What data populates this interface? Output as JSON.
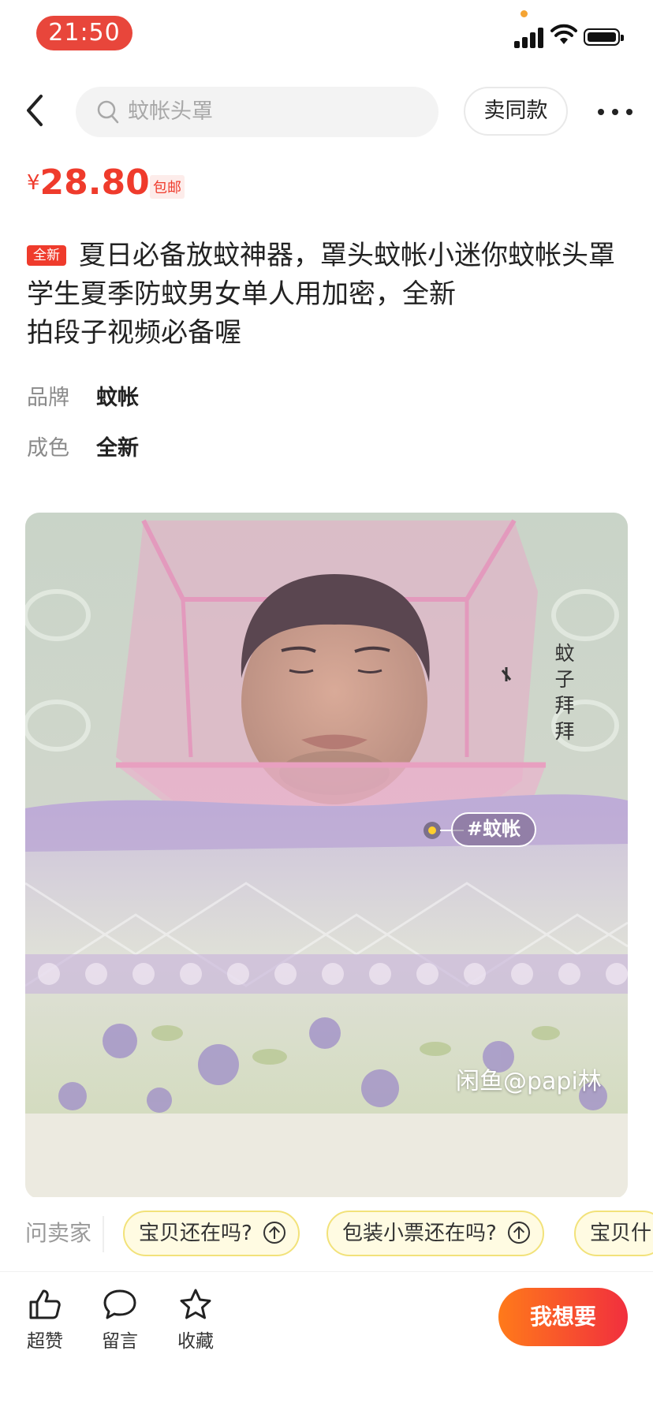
{
  "status_bar": {
    "time": "21:50"
  },
  "nav": {
    "search_placeholder": "蚊帐头罩",
    "sell_same_label": "卖同款"
  },
  "product": {
    "currency": "¥",
    "price": "28.80",
    "shipping": "包邮",
    "condition_badge": "全新",
    "title": "夏日必备放蚊神器，罩头蚊帐小迷你蚊帐头罩学生夏季防蚊男女单人用加密，全新",
    "title_line2": "拍段子视频必备喔",
    "attributes": [
      {
        "key": "品牌",
        "value": "蚊帐"
      },
      {
        "key": "成色",
        "value": "全新"
      }
    ]
  },
  "photo": {
    "vertical_caption": [
      "蚊",
      "子",
      "拜",
      "拜"
    ],
    "tag": "#蚊帐",
    "watermark": "闲鱼@papi林"
  },
  "quick_questions": {
    "label": "问卖家",
    "chips": [
      "宝贝还在吗?",
      "包装小票还在吗?",
      "宝贝什"
    ]
  },
  "bottom_bar": {
    "actions": [
      {
        "label": "超赞",
        "icon": "thumbs-up-icon"
      },
      {
        "label": "留言",
        "icon": "comment-icon"
      },
      {
        "label": "收藏",
        "icon": "star-icon"
      }
    ],
    "want_label": "我想要"
  },
  "colors": {
    "accent": "#ef3b2c",
    "status_pill": "#e8463b",
    "chip_border": "#f2e27a",
    "want_gradient": [
      "#ff7a1a",
      "#f12f3e"
    ]
  }
}
